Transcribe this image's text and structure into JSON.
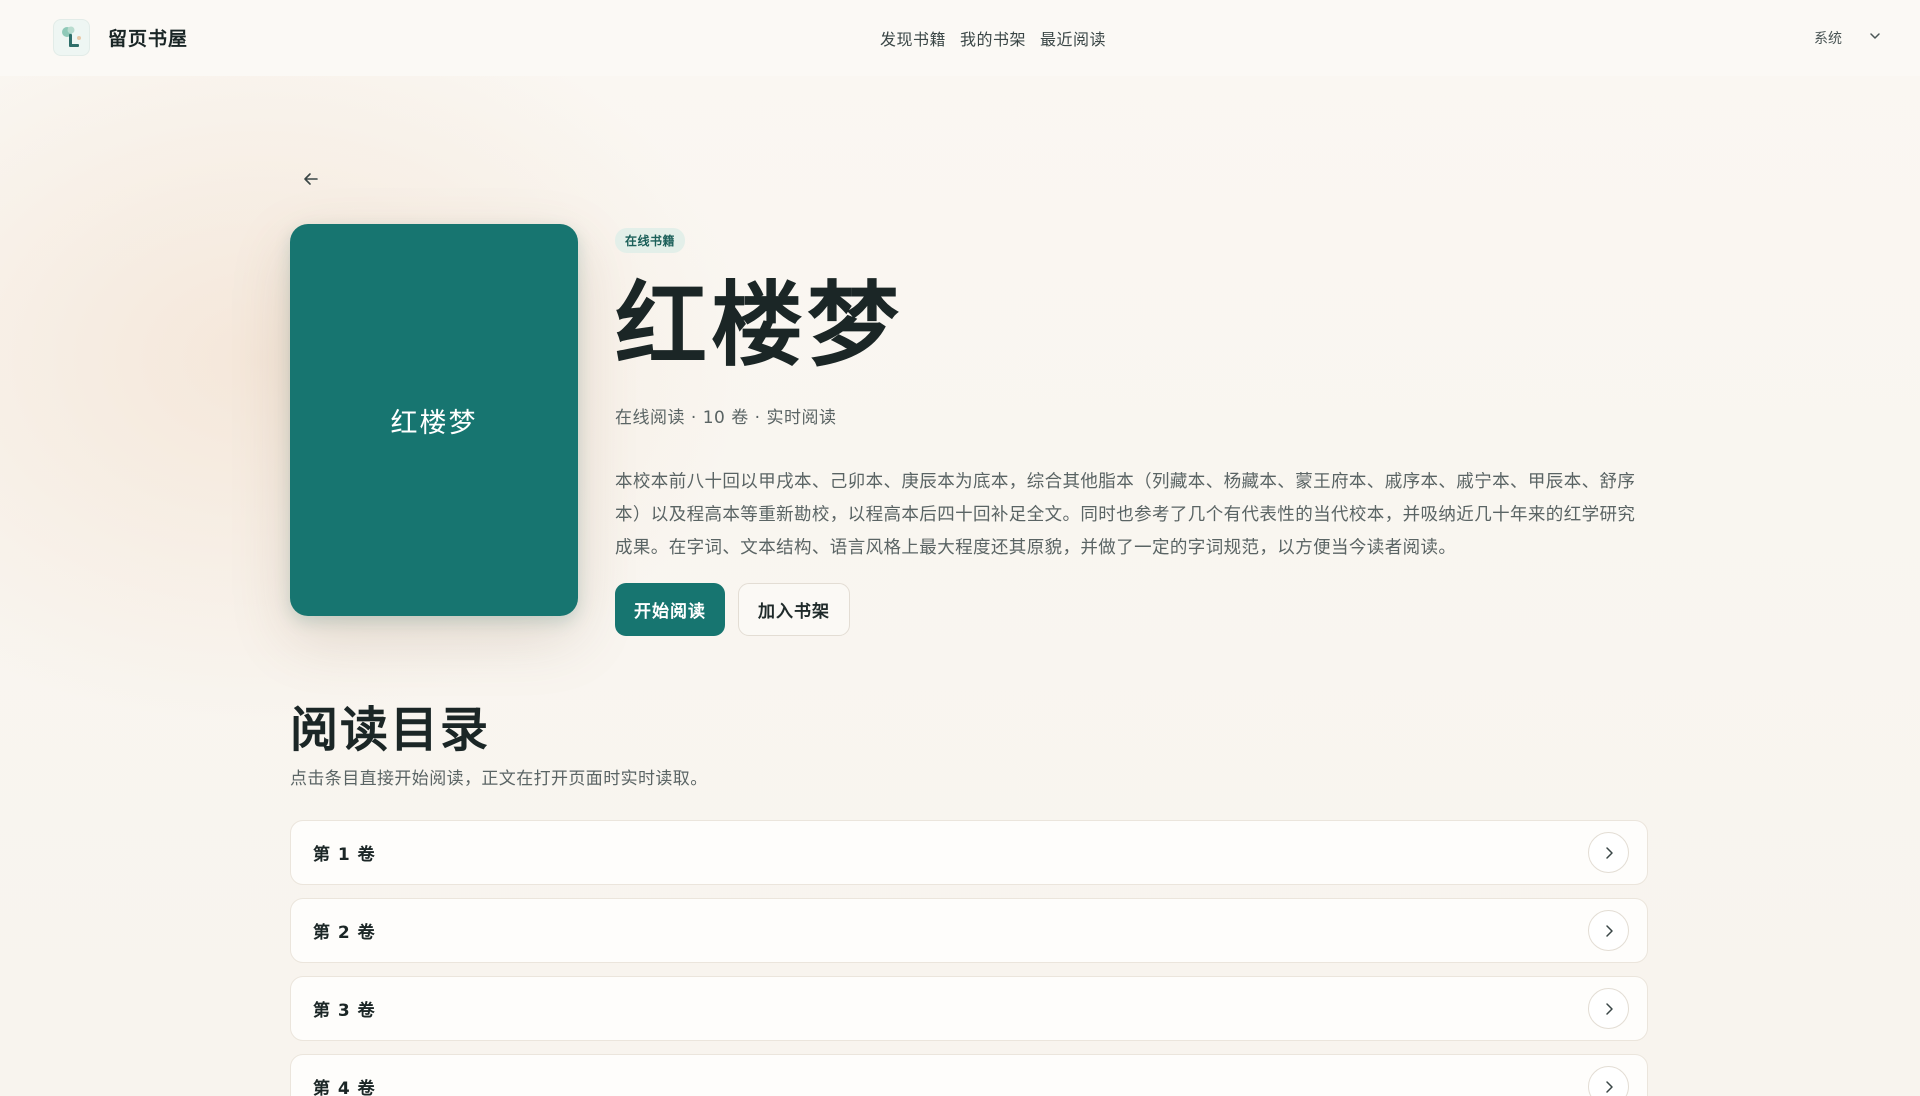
{
  "header": {
    "brand_name": "留页书屋",
    "nav": [
      {
        "label": "发现书籍"
      },
      {
        "label": "我的书架"
      },
      {
        "label": "最近阅读"
      }
    ],
    "theme_select": {
      "value": "系统",
      "icon": "chevron-down-icon"
    }
  },
  "back": {
    "icon": "arrow-left-icon"
  },
  "book": {
    "cover_title": "红楼梦",
    "badge": "在线书籍",
    "title": "红楼梦",
    "meta": "在线阅读 · 10 卷 · 实时阅读",
    "description": "本校本前八十回以甲戌本、己卯本、庚辰本为底本，综合其他脂本（列藏本、杨藏本、蒙王府本、戚序本、戚宁本、甲辰本、舒序本）以及程高本等重新勘校，以程高本后四十回补足全文。同时也参考了几个有代表性的当代校本，并吸纳近几十年来的红学研究成果。在字词、文本结构、语言风格上最大程度还其原貌，并做了一定的字词规范，以方便当今读者阅读。",
    "primary_action": "开始阅读",
    "secondary_action": "加入书架"
  },
  "toc": {
    "title": "阅读目录",
    "subtitle": "点击条目直接开始阅读，正文在打开页面时实时读取。",
    "items": [
      {
        "label": "第 1 卷"
      },
      {
        "label": "第 2 卷"
      },
      {
        "label": "第 3 卷"
      },
      {
        "label": "第 4 卷"
      }
    ]
  },
  "colors": {
    "accent": "#177570",
    "background": "#faf7f2",
    "badge_bg": "#e3efe9"
  }
}
